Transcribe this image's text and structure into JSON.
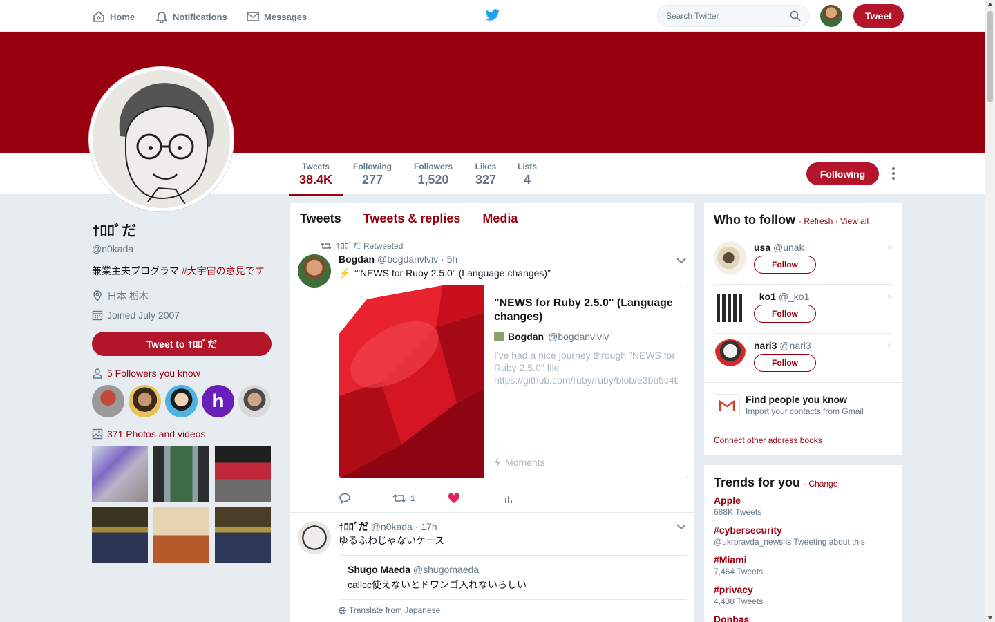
{
  "nav": {
    "home": "Home",
    "notifications": "Notifications",
    "messages": "Messages",
    "search_placeholder": "Search Twitter",
    "tweet_button": "Tweet"
  },
  "profile": {
    "name": "†ﾛﾛﾞだ",
    "handle": "@n0kada",
    "bio_text": "兼業主夫プログラマ ",
    "bio_hashtag": "#大宇宙の意見です",
    "location": "日本 栃木",
    "joined": "Joined July 2007",
    "tweet_to": "Tweet to †ﾛﾛﾞだ",
    "followers_you_know": "5 Followers you know",
    "photos_videos": "371 Photos and videos"
  },
  "stats": [
    {
      "label": "Tweets",
      "value": "38.4K"
    },
    {
      "label": "Following",
      "value": "277"
    },
    {
      "label": "Followers",
      "value": "1,520"
    },
    {
      "label": "Likes",
      "value": "327"
    },
    {
      "label": "Lists",
      "value": "4"
    }
  ],
  "following_button": "Following",
  "timeline": {
    "tabs": [
      "Tweets",
      "Tweets & replies",
      "Media"
    ],
    "tweet1": {
      "retweeted_by": "†ﾛﾛﾞだ Retweeted",
      "name": "Bogdan",
      "handle": "@bogdanvlviv",
      "time": "· 5h",
      "text": "⚡ “\"NEWS for Ruby 2.5.0\" (Language changes)”",
      "card_title": "\"NEWS for Ruby 2.5.0\" (Language changes)",
      "card_author": "Bogdan",
      "card_author_handle": "@bogdanvlviv",
      "card_desc_1": "I've had a nice journey through \"NEWS for",
      "card_desc_2": "Ruby 2.5.0\" file",
      "card_desc_3": "https://github.com/ruby/ruby/blob/e3bb5c4b",
      "card_moments": "Moments",
      "retweet_count": "1"
    },
    "tweet2": {
      "name": "†ﾛﾛﾞだ",
      "handle": "@n0kada",
      "time": "· 17h",
      "text": "ゆるふわじゃないケース",
      "quote_name": "Shugo Maeda",
      "quote_handle": "@shugomaeda",
      "quote_text": "callcc使えないとドワンゴ入れないらしい",
      "translate": "Translate from Japanese"
    }
  },
  "who_to_follow": {
    "title": "Who to follow",
    "refresh": "· Refresh",
    "view_all": "· View all",
    "users": [
      {
        "name": "usa",
        "handle": "@unak",
        "button": "Follow"
      },
      {
        "name": "_ko1",
        "handle": "@_ko1",
        "button": "Follow"
      },
      {
        "name": "nari3",
        "handle": "@nari3",
        "button": "Follow"
      }
    ],
    "close": "×",
    "find_title": "Find people you know",
    "find_sub": "Import your contacts from Gmail",
    "connect": "Connect other address books"
  },
  "trends": {
    "title": "Trends for you",
    "change": "· Change",
    "items": [
      {
        "name": "Apple",
        "count": "688K Tweets"
      },
      {
        "name": "#cybersecurity",
        "count": "@ukrpravda_news is Tweeting about this"
      },
      {
        "name": "#Miami",
        "count": "7,464 Tweets"
      },
      {
        "name": "#privacy",
        "count": "4,438 Tweets"
      },
      {
        "name": "Donbas",
        "count": ""
      }
    ]
  },
  "colors": {
    "accent": "#99000f",
    "button": "#b3152a",
    "like": "#e0245e",
    "twitter_blue": "#1da1f2"
  }
}
